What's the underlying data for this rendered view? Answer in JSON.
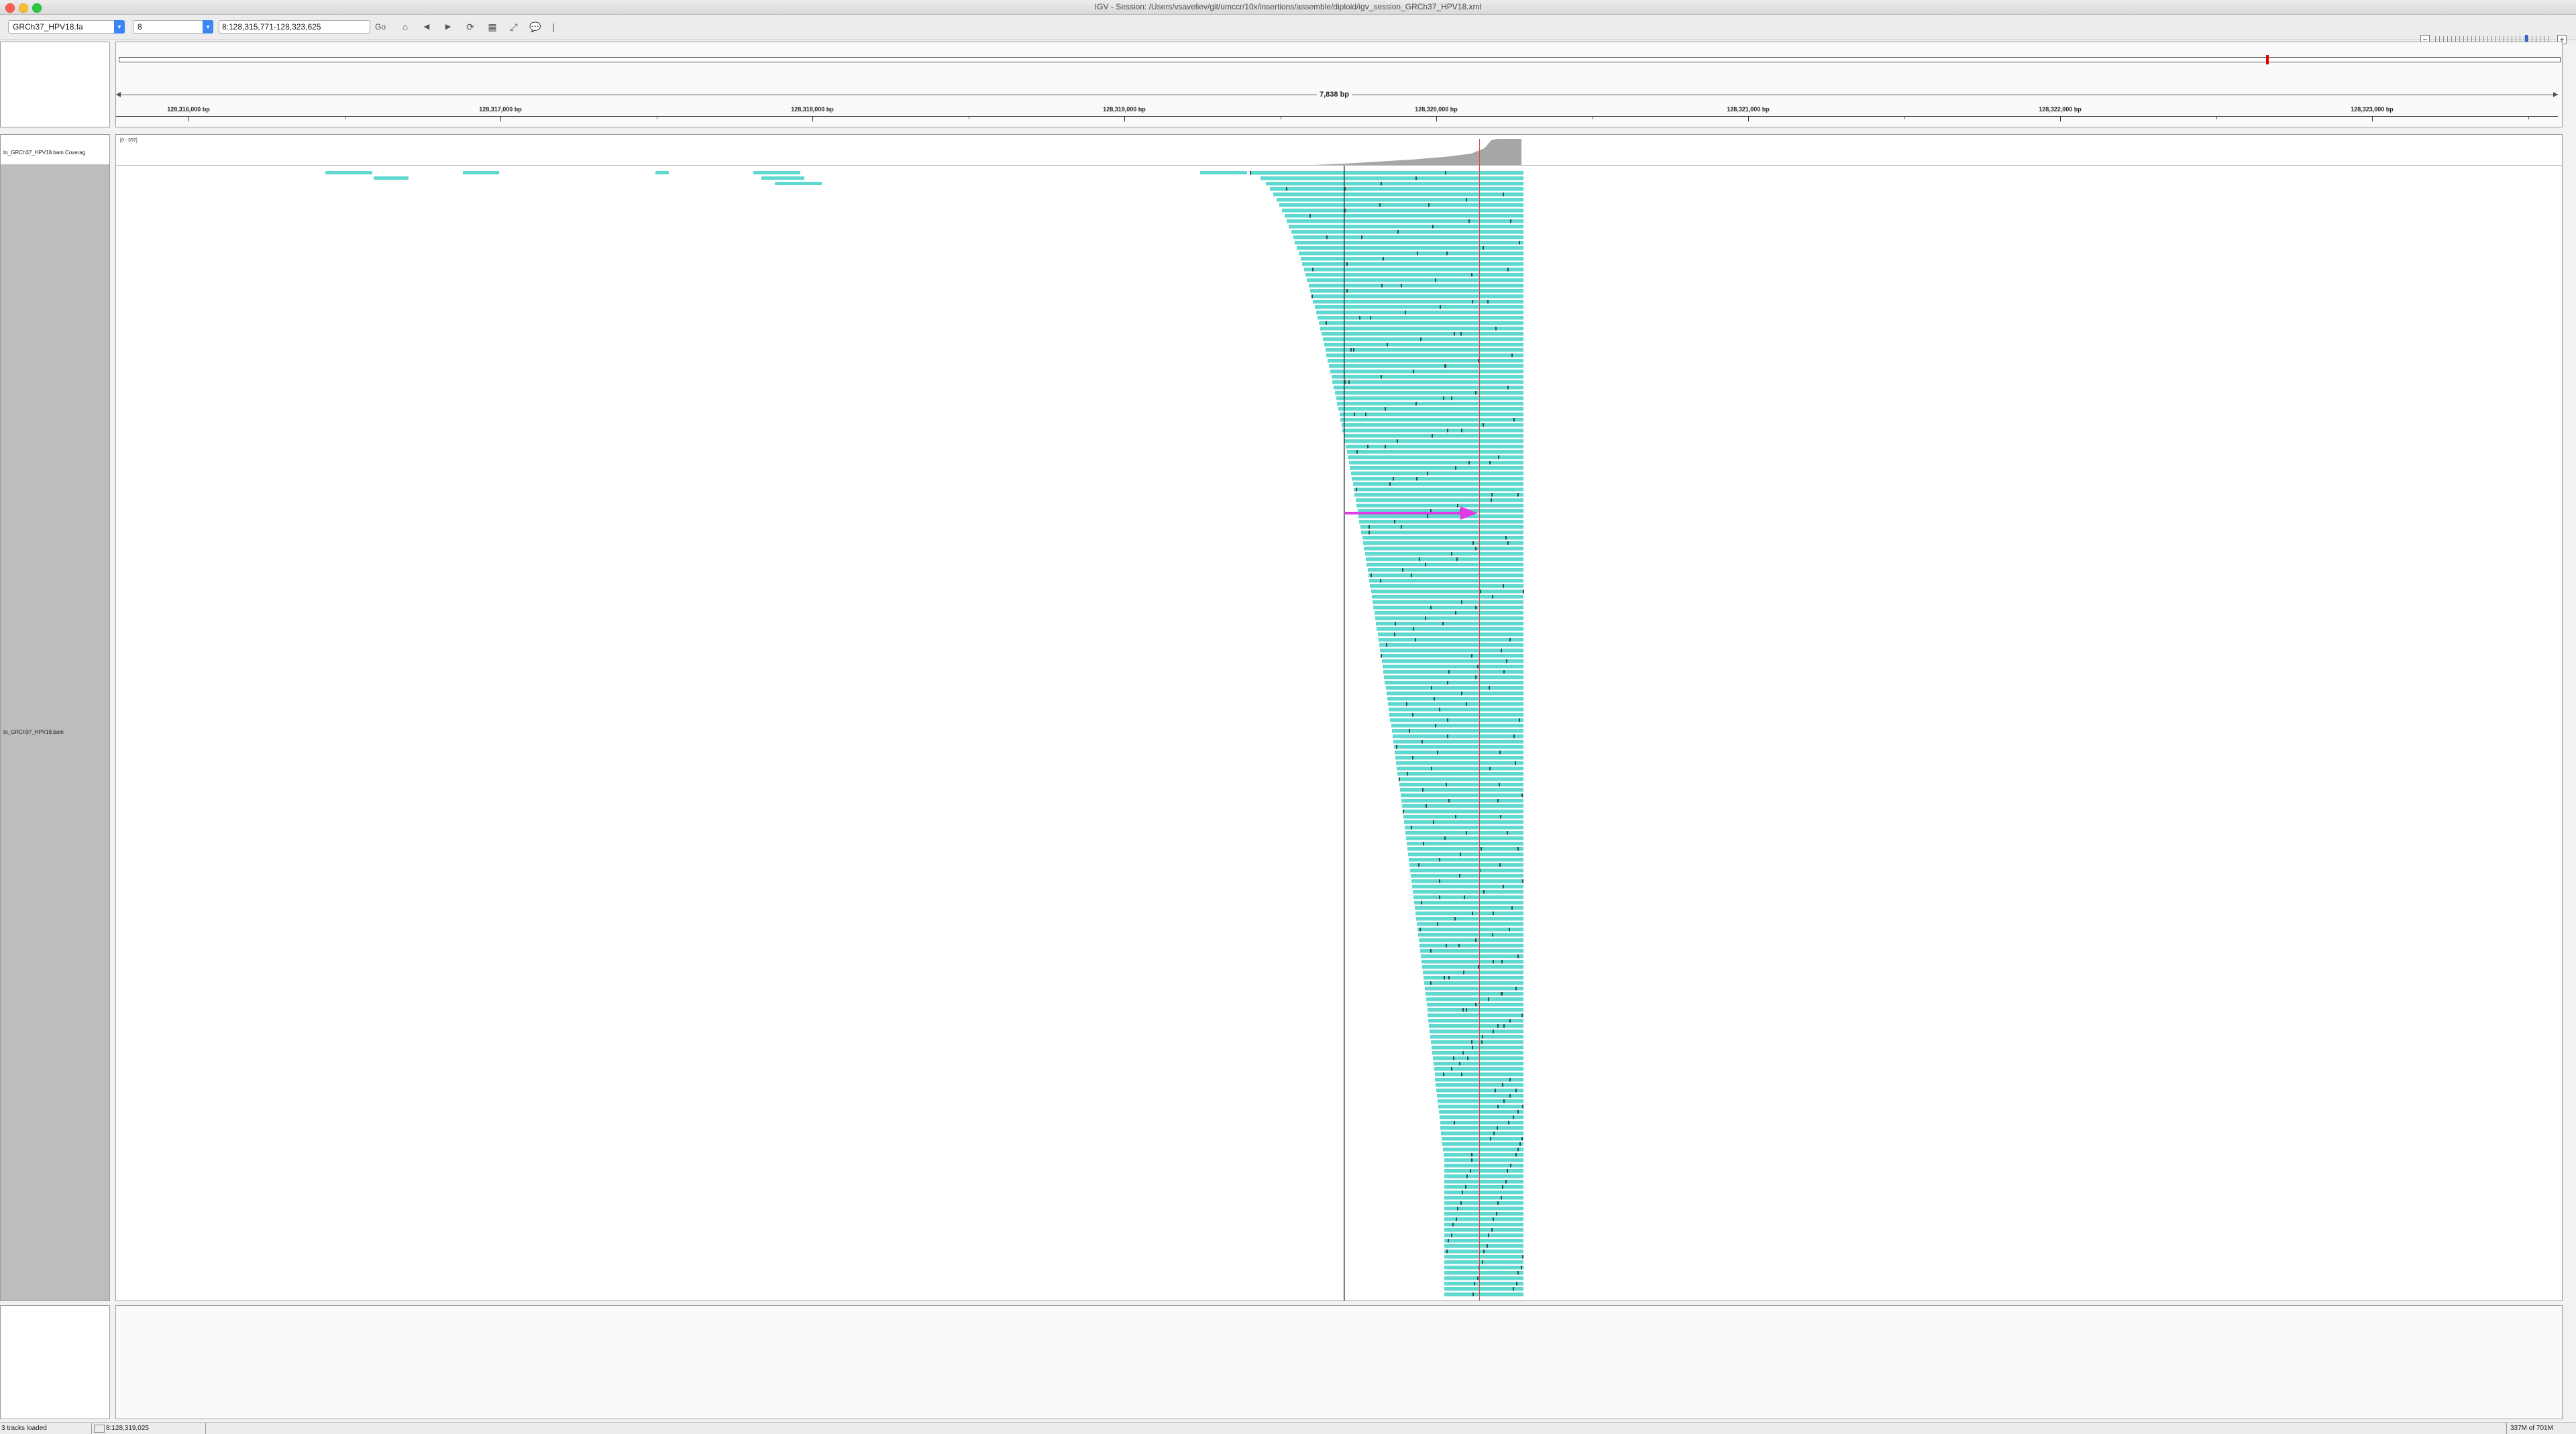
{
  "window": {
    "title": "IGV - Session: /Users/vsaveliev/git/umccr/10x/insertions/assemble/diploid/igv_session_GRCh37_HPV18.xml"
  },
  "toolbar": {
    "genome": "GRCh37_HPV18.fa",
    "chromosome": "8",
    "locus": "8:128,315,771-128,323,625",
    "go_label": "Go",
    "icons": [
      "home-icon",
      "back-icon",
      "forward-icon",
      "refresh-icon",
      "region-of-interest-icon",
      "resize-icon",
      "popup-text-icon",
      "ruler-icon"
    ],
    "zoom": {
      "minus": "−",
      "plus": "+",
      "level_fraction": 0.77
    }
  },
  "ruler": {
    "span_label": "7,838 bp",
    "ticks": [
      "128,316,000 bp",
      "128,317,000 bp",
      "128,318,000 bp",
      "128,319,000 bp",
      "128,320,000 bp",
      "128,321,000 bp",
      "128,322,000 bp",
      "128,323,000 bp"
    ]
  },
  "tracks": {
    "coverage_name": "to_GRCh37_HPV18.bam Coverag",
    "coverage_range": "[0 - 397]",
    "alignment_name": "to_GRCh37_HPV18.bam"
  },
  "alignment": {
    "read_color": "#5fd9cf",
    "mismatch_color": "#2c4f48",
    "coverage_color": "#a6a6a6",
    "highlight_color": "#e23be6",
    "locus_line_color": "#e04a4a"
  },
  "status": {
    "tracks_loaded": "3 tracks loaded",
    "position": "8:128,319,025",
    "memory": "337M of 701M"
  }
}
